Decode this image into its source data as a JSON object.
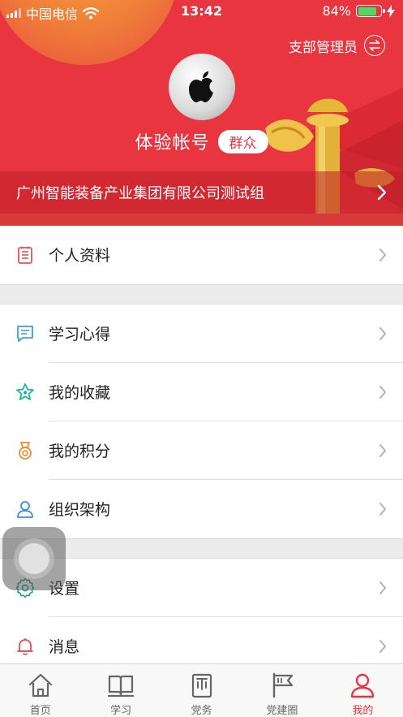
{
  "status_bar": {
    "carrier": "中国电信",
    "time": "13:42",
    "battery": "84%"
  },
  "header": {
    "admin_link": "支部管理员",
    "user_name": "体验帐号",
    "role_badge": "群众",
    "org_name": "广州智能装备产业集团有限公司测试组"
  },
  "menu": {
    "profile": "个人资料",
    "study_notes": "学习心得",
    "favorites": "我的收藏",
    "points": "我的积分",
    "org_structure": "组织架构",
    "settings": "设置",
    "messages": "消息"
  },
  "tabs": [
    {
      "label": "首页",
      "icon": "home-icon"
    },
    {
      "label": "学习",
      "icon": "book-icon"
    },
    {
      "label": "党务",
      "icon": "party-affairs-icon"
    },
    {
      "label": "党建圈",
      "icon": "flag-icon"
    },
    {
      "label": "我的",
      "icon": "person-icon"
    }
  ],
  "colors": {
    "brand_red": "#e9353f",
    "divider": "#e2e2e2",
    "section_gap": "#ececec"
  }
}
